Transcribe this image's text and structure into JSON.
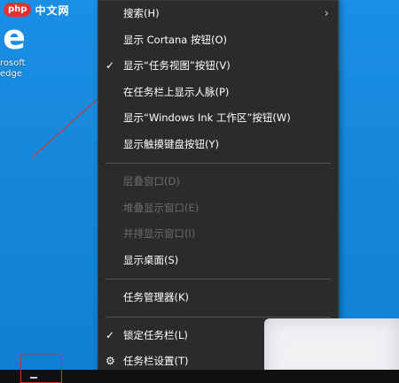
{
  "watermark": {
    "badge": "php",
    "text": "中文网"
  },
  "desktop_icon": {
    "label": "rosoft\nedge",
    "glyph": "e"
  },
  "menu": {
    "items": [
      {
        "label": "搜索(H)",
        "state": "normal",
        "submenu": true,
        "check": false
      },
      {
        "label": "显示 Cortana 按钮(O)",
        "state": "normal",
        "submenu": false,
        "check": false
      },
      {
        "label": "显示“任务视图”按钮(V)",
        "state": "normal",
        "submenu": false,
        "check": true
      },
      {
        "label": "在任务栏上显示人脉(P)",
        "state": "normal",
        "submenu": false,
        "check": false
      },
      {
        "label": "显示“Windows Ink 工作区”按钮(W)",
        "state": "normal",
        "submenu": false,
        "check": false
      },
      {
        "label": "显示触摸键盘按钮(Y)",
        "state": "normal",
        "submenu": false,
        "check": false
      },
      {
        "label": "层叠窗口(D)",
        "state": "disabled",
        "submenu": false,
        "check": false
      },
      {
        "label": "堆叠显示窗口(E)",
        "state": "disabled",
        "submenu": false,
        "check": false
      },
      {
        "label": "并排显示窗口(I)",
        "state": "disabled",
        "submenu": false,
        "check": false
      },
      {
        "label": "显示桌面(S)",
        "state": "normal",
        "submenu": false,
        "check": false
      },
      {
        "label": "任务管理器(K)",
        "state": "normal",
        "submenu": false,
        "check": false
      },
      {
        "label": "锁定任务栏(L)",
        "state": "normal",
        "submenu": false,
        "check": true
      },
      {
        "label": "任务栏设置(T)",
        "state": "normal",
        "submenu": false,
        "check": false,
        "icon": "gear-icon"
      }
    ]
  },
  "colors": {
    "menu_bg": "#2b2b2b",
    "desktop_blue": "#1b8fe6",
    "annotation": "#d03030"
  }
}
